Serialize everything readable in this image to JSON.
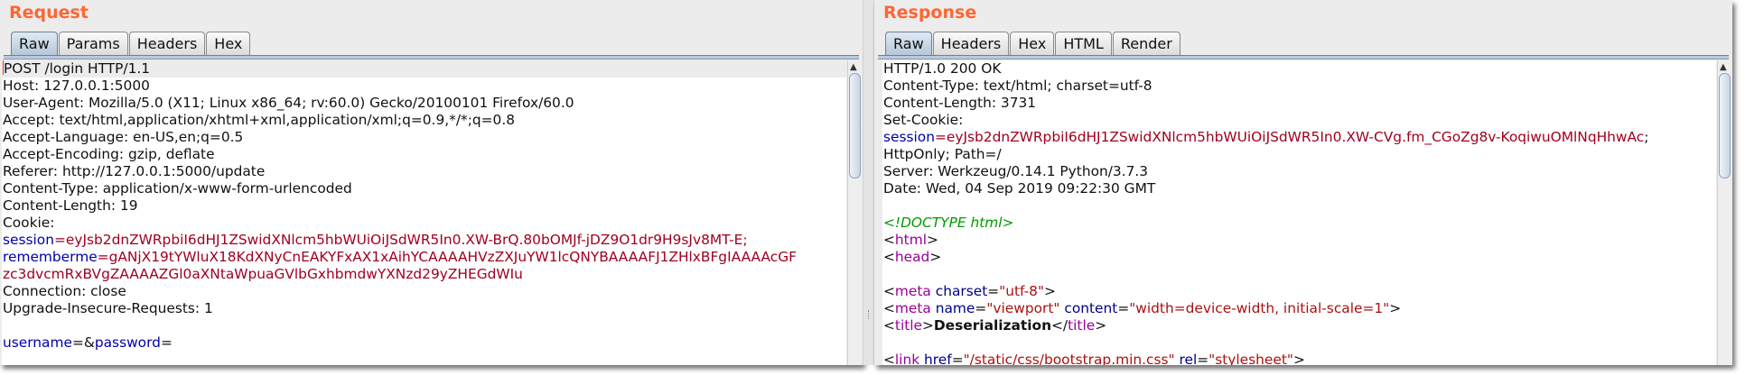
{
  "request": {
    "title": "Request",
    "tabs": [
      "Raw",
      "Params",
      "Headers",
      "Hex"
    ],
    "active_tab": "Raw",
    "scrollbar_position": 0.0,
    "lines": [
      [
        {
          "t": "POST /login HTTP/1.1"
        }
      ],
      [
        {
          "t": "Host: 127.0.0.1:5000"
        }
      ],
      [
        {
          "t": "User-Agent: Mozilla/5.0 (X11; Linux x86_64; rv:60.0) Gecko/20100101 Firefox/60.0"
        }
      ],
      [
        {
          "t": "Accept: text/html,application/xhtml+xml,application/xml;q=0.9,*/*;q=0.8"
        }
      ],
      [
        {
          "t": "Accept-Language: en-US,en;q=0.5"
        }
      ],
      [
        {
          "t": "Accept-Encoding: gzip, deflate"
        }
      ],
      [
        {
          "t": "Referer: http://127.0.0.1:5000/update"
        }
      ],
      [
        {
          "t": "Content-Type: application/x-www-form-urlencoded"
        }
      ],
      [
        {
          "t": "Content-Length: 19"
        }
      ],
      [
        {
          "t": "Cookie:"
        }
      ],
      [
        {
          "t": "session",
          "c": "k"
        },
        {
          "t": "=eyJsb2dnZWRpbiI6dHJ1ZSwidXNlcm5hbWUiOiJSdWR5In0.XW-BrQ.80bOMJf-jDZ9O1dr9H9sJv8MT-E;",
          "c": "v"
        }
      ],
      [
        {
          "t": "rememberme",
          "c": "k"
        },
        {
          "t": "=gANjX19tYWluX18KdXNyCnEAKYFxAX1xAihYCAAAAHVzZXJuYW1lcQNYBAAAAFJ1ZHlxBFgIAAAAcGF",
          "c": "v"
        }
      ],
      [
        {
          "t": "zc3dvcmRxBVgZAAAAZGl0aXNtaWpuaGVlbGxhbmdwYXNzd29yZHEGdWIu",
          "c": "v"
        }
      ],
      [
        {
          "t": "Connection: close"
        }
      ],
      [
        {
          "t": "Upgrade-Insecure-Requests: 1"
        }
      ],
      [
        {
          "t": ""
        }
      ],
      [
        {
          "t": "username",
          "c": "k"
        },
        {
          "t": "=&"
        },
        {
          "t": "password",
          "c": "k"
        },
        {
          "t": "="
        }
      ]
    ]
  },
  "response": {
    "title": "Response",
    "tabs": [
      "Raw",
      "Headers",
      "Hex",
      "HTML",
      "Render"
    ],
    "active_tab": "Raw",
    "scrollbar_position": 0.0,
    "lines": [
      [
        {
          "t": "HTTP/1.0 200 OK"
        }
      ],
      [
        {
          "t": "Content-Type: text/html; charset=utf-8"
        }
      ],
      [
        {
          "t": "Content-Length: 3731"
        }
      ],
      [
        {
          "t": "Set-Cookie:"
        }
      ],
      [
        {
          "t": "session",
          "c": "k"
        },
        {
          "t": "=eyJsb2dnZWRpbiI6dHJ1ZSwidXNlcm5hbWUiOiJSdWR5In0.XW-CVg.fm_CGoZg8v-KoqiwuOMlNqHhwAc",
          "c": "v"
        },
        {
          "t": ";"
        }
      ],
      [
        {
          "t": "HttpOnly; Path=/"
        }
      ],
      [
        {
          "t": "Server: Werkzeug/0.14.1 Python/3.7.3"
        }
      ],
      [
        {
          "t": "Date: Wed, 04 Sep 2019 09:22:30 GMT"
        }
      ],
      [
        {
          "t": ""
        }
      ],
      [
        {
          "t": "<!DOCTYPE html>",
          "c": "g"
        }
      ],
      [
        {
          "t": "<"
        },
        {
          "t": "html",
          "c": "t"
        },
        {
          "t": ">"
        }
      ],
      [
        {
          "t": "<"
        },
        {
          "t": "head",
          "c": "t"
        },
        {
          "t": ">"
        }
      ],
      [
        {
          "t": ""
        }
      ],
      [
        {
          "t": "<"
        },
        {
          "t": "meta",
          "c": "t"
        },
        {
          "t": " "
        },
        {
          "t": "charset",
          "c": "an"
        },
        {
          "t": "="
        },
        {
          "t": "\"utf-8\"",
          "c": "av"
        },
        {
          "t": ">"
        }
      ],
      [
        {
          "t": "<"
        },
        {
          "t": "meta",
          "c": "t"
        },
        {
          "t": " "
        },
        {
          "t": "name",
          "c": "an"
        },
        {
          "t": "="
        },
        {
          "t": "\"viewport\"",
          "c": "av"
        },
        {
          "t": " "
        },
        {
          "t": "content",
          "c": "an"
        },
        {
          "t": "="
        },
        {
          "t": "\"width=device-width, initial-scale=1\"",
          "c": "av"
        },
        {
          "t": ">"
        }
      ],
      [
        {
          "t": "<"
        },
        {
          "t": "title",
          "c": "t"
        },
        {
          "t": ">"
        },
        {
          "t": "Deserialization",
          "c": "b"
        },
        {
          "t": "</"
        },
        {
          "t": "title",
          "c": "t"
        },
        {
          "t": ">"
        }
      ],
      [
        {
          "t": ""
        }
      ],
      [
        {
          "t": "<"
        },
        {
          "t": "link",
          "c": "t"
        },
        {
          "t": " "
        },
        {
          "t": "href",
          "c": "an"
        },
        {
          "t": "="
        },
        {
          "t": "\"/static/css/bootstrap.min.css\"",
          "c": "av"
        },
        {
          "t": " "
        },
        {
          "t": "rel",
          "c": "an"
        },
        {
          "t": "="
        },
        {
          "t": "\"stylesheet\"",
          "c": "av"
        },
        {
          "t": ">"
        }
      ]
    ]
  }
}
